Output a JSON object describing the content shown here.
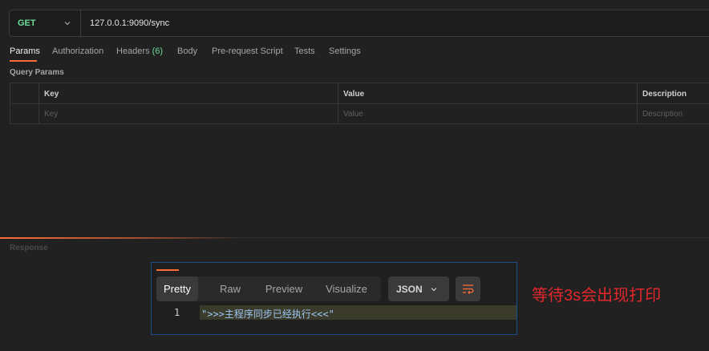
{
  "request": {
    "method": "GET",
    "url": "127.0.0.1:9090/sync"
  },
  "tabs": [
    {
      "label": "Params",
      "active": true
    },
    {
      "label": "Authorization"
    },
    {
      "label": "Headers",
      "count": "(6)"
    },
    {
      "label": "Body"
    },
    {
      "label": "Pre-request Script"
    },
    {
      "label": "Tests"
    },
    {
      "label": "Settings"
    }
  ],
  "query_params": {
    "title": "Query Params",
    "columns": [
      "Key",
      "Value",
      "Description"
    ],
    "placeholders": [
      "Key",
      "Value",
      "Description"
    ]
  },
  "response": {
    "label": "Response",
    "view_tabs": [
      "Pretty",
      "Raw",
      "Preview",
      "Visualize"
    ],
    "active_view": "Pretty",
    "format": "JSON",
    "lines": [
      {
        "number": "1",
        "text": "\">>>主程序同步已经执行<<<\""
      }
    ]
  },
  "annotation": "等待3s会出现打印",
  "colors": {
    "accent": "#ff6c37",
    "method": "#6bdd9a",
    "annotation": "#e2272b",
    "highlight_border": "#1e4f8c"
  }
}
